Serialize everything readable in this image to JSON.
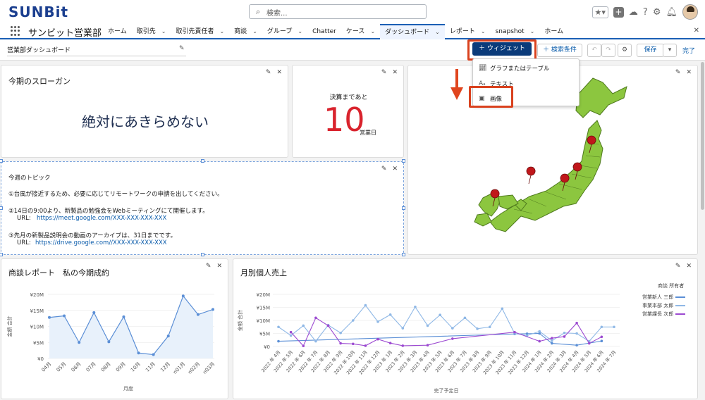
{
  "topbar": {
    "logo": "SUNBit",
    "search_placeholder": "検索..."
  },
  "nav": {
    "app_name": "サンビット営業部",
    "items": [
      {
        "label": "ホーム",
        "chevron": false
      },
      {
        "label": "取引先",
        "chevron": true
      },
      {
        "label": "取引先責任者",
        "chevron": true
      },
      {
        "label": "商談",
        "chevron": true
      },
      {
        "label": "グループ",
        "chevron": true
      },
      {
        "label": "Chatter",
        "chevron": false
      },
      {
        "label": "ケース",
        "chevron": true
      },
      {
        "label": "ダッシュボード",
        "chevron": true,
        "active": true
      },
      {
        "label": "レポート",
        "chevron": true
      },
      {
        "label": "snapshot",
        "chevron": true
      },
      {
        "label": "ホーム",
        "chevron": false
      }
    ]
  },
  "dashboard": {
    "title": "営業部ダッシュボード",
    "widget_button": "＋ ウィジェット",
    "filter_button": "＋ 検索条件",
    "save_button": "保存",
    "done_button": "完了"
  },
  "dropdown": {
    "items": [
      {
        "label": "グラフまたはテーブル",
        "icon": "chart-icon"
      },
      {
        "label": "テキスト",
        "icon": "text-icon"
      },
      {
        "label": "画像",
        "icon": "image-icon"
      }
    ]
  },
  "slogan_card": {
    "title": "今期のスローガン",
    "text": "絶対にあきらめない"
  },
  "countdown_card": {
    "label": "決算まであと",
    "number": "10",
    "unit": "営業日"
  },
  "topic_card": {
    "title": "今週のトピック",
    "line1": "①台風が接近するため、必要に応じてリモートワークの申請を出してください。",
    "line2": "②14日の9:00より、新製品の勉強会をWebミーティングにて開催します。",
    "line2_url_label": "URL:",
    "line2_url": "https://meet.google.com/XXX-XXX-XXX-XXX",
    "line3": "③先月の新製品説明会の動画のアーカイブは、31日までです。",
    "line3_url_label": "URL:",
    "line3_url": "https://drive.google.com//XXX-XXX-XXX-XXX"
  },
  "colors": {
    "accent": "#0b3b7a",
    "highlight": "#d9411e",
    "map_green": "#8cc63f",
    "pin_red": "#c0171b"
  },
  "chart_data": [
    {
      "type": "area",
      "title": "商談レポート　私の今期成約",
      "xlabel": "月度",
      "ylabel": "金額 合計",
      "categories": [
        "04月",
        "05月",
        "06月",
        "07月",
        "08月",
        "09月",
        "10月",
        "11月",
        "12月",
        "n01月",
        "n02月",
        "n03月"
      ],
      "y_ticks": [
        "¥0",
        "¥5M",
        "¥10M",
        "¥15M",
        "¥20M"
      ],
      "ylim": [
        0,
        20000000
      ],
      "values": [
        12800000,
        13300000,
        5000000,
        14300000,
        5200000,
        13000000,
        1700000,
        1200000,
        7000000,
        19500000,
        13700000,
        15300000
      ]
    },
    {
      "type": "line",
      "title": "月別個人売上",
      "xlabel": "完了予定日",
      "ylabel": "金額 合計",
      "legend_title": "商談 所有者",
      "y_ticks": [
        "¥0",
        "¥5M",
        "¥10M",
        "¥15M",
        "¥20M"
      ],
      "ylim": [
        0,
        20000000
      ],
      "x_tick_labels": [
        "2022 年 4月",
        "2022 年 5月",
        "2022 年 6月",
        "2022 年 7月",
        "2022 年 8月",
        "2022 年 9月",
        "2022 年 10月",
        "2022 年 11月",
        "2022 年 12月",
        "2023 年 1月",
        "2023 年 2月",
        "2023 年 3月",
        "2023 年 4月",
        "2023 年 5月",
        "2023 年 6月",
        "2023 年 7月",
        "2023 年 8月",
        "2023 年 9月",
        "2023 年 10月",
        "2023 年 11月",
        "2023 年 12月",
        "2024 年 1月",
        "2024 年 2月",
        "2024 年 3月",
        "2024 年 4月",
        "2024 年 5月",
        "2024 年 6月",
        "2024 年 7月"
      ],
      "series": [
        {
          "name": "営業新人 三郎",
          "color": "#5b8fd6",
          "points": [
            [
              0,
              2000000
            ],
            [
              19,
              4800000
            ],
            [
              20,
              4900000
            ],
            [
              21,
              5000000
            ],
            [
              22,
              1200000
            ],
            [
              24,
              500000
            ],
            [
              26,
              2100000
            ]
          ]
        },
        {
          "name": "事業本部 太郎",
          "color": "#8fb8e6",
          "points": [
            [
              0,
              7500000
            ],
            [
              1,
              4200000
            ],
            [
              2,
              8000000
            ],
            [
              3,
              2000000
            ],
            [
              4,
              8200000
            ],
            [
              5,
              5200000
            ],
            [
              6,
              10000000
            ],
            [
              7,
              15800000
            ],
            [
              8,
              9500000
            ],
            [
              9,
              12200000
            ],
            [
              10,
              7000000
            ],
            [
              11,
              15200000
            ],
            [
              12,
              8000000
            ],
            [
              13,
              12100000
            ],
            [
              14,
              7000000
            ],
            [
              15,
              11000000
            ],
            [
              16,
              6800000
            ],
            [
              17,
              7500000
            ],
            [
              18,
              14500000
            ],
            [
              19,
              5000000
            ],
            [
              20,
              4200000
            ],
            [
              21,
              5800000
            ],
            [
              22,
              2200000
            ],
            [
              23,
              5200000
            ],
            [
              24,
              5000000
            ],
            [
              25,
              2000000
            ],
            [
              26,
              7500000
            ],
            [
              27,
              7500000
            ]
          ]
        },
        {
          "name": "営業課長 次郎",
          "color": "#9c4ad1",
          "points": [
            [
              1,
              5500000
            ],
            [
              2,
              200000
            ],
            [
              3,
              11000000
            ],
            [
              4,
              8000000
            ],
            [
              5,
              1200000
            ],
            [
              6,
              1000000
            ],
            [
              7,
              300000
            ],
            [
              8,
              2800000
            ],
            [
              9,
              1300000
            ],
            [
              10,
              300000
            ],
            [
              12,
              500000
            ],
            [
              14,
              3000000
            ],
            [
              19,
              5500000
            ],
            [
              21,
              2000000
            ],
            [
              22,
              3200000
            ],
            [
              23,
              3800000
            ],
            [
              24,
              9000000
            ],
            [
              25,
              1200000
            ],
            [
              26,
              3700000
            ]
          ]
        }
      ]
    }
  ]
}
